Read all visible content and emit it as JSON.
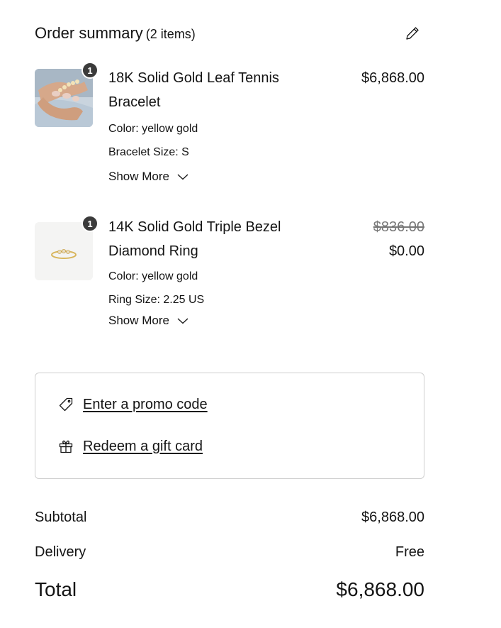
{
  "header": {
    "title": "Order summary",
    "count": "(2 items)"
  },
  "items": [
    {
      "quantity": "1",
      "name_line1": "18K Solid Gold Leaf Tennis",
      "name_line2": "Bracelet",
      "options": [
        "Color: yellow gold",
        "Bracelet Size: S"
      ],
      "show_more": "Show More",
      "price": "$6,868.00"
    },
    {
      "quantity": "1",
      "name_line1": "14K Solid Gold Triple Bezel",
      "name_line2": "Diamond Ring",
      "options": [
        "Color: yellow gold",
        "Ring Size: 2.25 US"
      ],
      "show_more": "Show More",
      "original_price": "$836.00",
      "price": "$0.00"
    }
  ],
  "promo": {
    "promo_code_label": "Enter a promo code",
    "gift_card_label": "Redeem a gift card"
  },
  "totals": {
    "subtotal_label": "Subtotal",
    "subtotal_value": "$6,868.00",
    "delivery_label": "Delivery",
    "delivery_value": "Free",
    "total_label": "Total",
    "total_value": "$6,868.00"
  },
  "colors": {
    "text": "#141414",
    "badge": "#3b3b3b",
    "border": "#cfcfcf",
    "strike": "#777777"
  },
  "icons": {
    "edit": "pencil-icon",
    "show_more": "chevron-down-icon",
    "promo": "tag-icon",
    "gift": "gift-icon"
  }
}
